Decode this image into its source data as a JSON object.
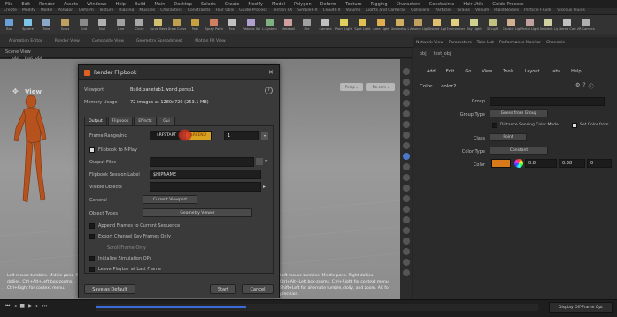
{
  "menubar": [
    "File",
    "Edit",
    "Render",
    "Assets",
    "Windows",
    "Help",
    "Build",
    "Main",
    "Desktop",
    "Solaris",
    "Create",
    "Modify",
    "Model",
    "Polygon",
    "Deform",
    "Texture",
    "Rigging",
    "Characters",
    "Constraints",
    "Hair Utils",
    "Guide Process"
  ],
  "shelf_tabs": [
    "Create",
    "Modify",
    "Model",
    "Polygon",
    "Deform",
    "Texture",
    "Rigging",
    "Muscles",
    "Characters",
    "Constraints",
    "Hair Utils",
    "Guide Process",
    "Terrain FX",
    "Simple FX",
    "Cloud FX",
    "Volume",
    "Lights and Cameras",
    "Collisions",
    "Particles",
    "Grains",
    "Vellum",
    "Rigid Bodies",
    "Particle Fluids",
    "Viscous Fluids"
  ],
  "shelf_tools": [
    {
      "label": "Box",
      "color": "#6aa0d8"
    },
    {
      "label": "Sphere",
      "color": "#7cc4e8"
    },
    {
      "label": "Tube",
      "color": "#8aa8c8"
    },
    {
      "label": "Torus",
      "color": "#c0a060"
    },
    {
      "label": "Grid",
      "color": "#8a8a8a"
    },
    {
      "label": "Null",
      "color": "#b0b0b0"
    },
    {
      "label": "Line",
      "color": "#a0a0a0"
    },
    {
      "label": "Circle",
      "color": "#a8a8a8"
    },
    {
      "label": "Curve Bezier",
      "color": "#d0c070"
    },
    {
      "label": "Draw Curve",
      "color": "#c0a050"
    },
    {
      "label": "Path",
      "color": "#c8a040"
    },
    {
      "label": "Spray Paint",
      "color": "#d08060"
    },
    {
      "label": "Font",
      "color": "#c0c0c0"
    },
    {
      "label": "Platonic Solids",
      "color": "#b0a0d0"
    },
    {
      "label": "L-System",
      "color": "#80b080"
    },
    {
      "label": "Metaball",
      "color": "#d0a0a0"
    },
    {
      "label": "File",
      "color": "#a0a0a0"
    },
    {
      "label": "Camera",
      "color": "#c0c0c0"
    },
    {
      "label": "Point Light",
      "color": "#e0d060"
    },
    {
      "label": "Spot Light",
      "color": "#e0c050"
    },
    {
      "label": "Area Light",
      "color": "#e0b050"
    },
    {
      "label": "Geometry Light",
      "color": "#d0b060"
    },
    {
      "label": "Volume Light",
      "color": "#c0a060"
    },
    {
      "label": "Distant Light",
      "color": "#e0c070"
    },
    {
      "label": "Environment Light",
      "color": "#e0d080"
    },
    {
      "label": "Sky Light",
      "color": "#d0d090"
    },
    {
      "label": "GI Light",
      "color": "#c0c080"
    },
    {
      "label": "Caustic Light",
      "color": "#d0b090"
    },
    {
      "label": "Portal Light",
      "color": "#c0a0a0"
    },
    {
      "label": "Ambient Light",
      "color": "#d0d0a0"
    },
    {
      "label": "Stereo Camera",
      "color": "#c0c0c0"
    },
    {
      "label": "VR Camera",
      "color": "#b0b0b0"
    }
  ],
  "shelf2": [
    "Animation Editor",
    "Render View",
    "Composite View",
    "Geometry Spreadsheet",
    "Motion FX View"
  ],
  "left_pane": {
    "tab": "Scene View",
    "path": [
      "obj",
      "test_obj"
    ]
  },
  "viewport": {
    "title": "View",
    "btn_persp": "Persp ▾",
    "btn_cam": "No cam ▾",
    "hint_left": "Left mouse tumbles. Middle pans.\nRight dollies. Ctrl+Alt+Left box-zooms.\nCtrl+Right for context menu.",
    "hint_right": "Left mouse tumbles. Middle pans. Right dollies. Ctrl+Alt+Left box-zooms. Ctrl+Right for context menu. Shift+Left for alternate tumble, dolly, and zoom. Alt for precision."
  },
  "dialog": {
    "title": "Render Flipbook",
    "viewport_label": "Viewport",
    "viewport_value": "Build.panetab1.world.persp1",
    "memory_label": "Memory Usage",
    "memory_value": "72 images at 1280x720 (253.1 MB)",
    "tabs": [
      "Output",
      "Flipbook",
      "Effects",
      "Gui"
    ],
    "frame_range_label": "Frame Range/Inc",
    "frame_start": "$RFSTART",
    "frame_end": "$RFEND",
    "frame_inc": "1",
    "flipbook_mplay": "Flipbook to MPlay",
    "output_files_label": "Output Files",
    "session_label": "Flipbook Session Label",
    "session_value": "$HIPNAME",
    "visible_objects_label": "Visible Objects",
    "general_label": "General",
    "general_value": "Current Viewport",
    "object_types_label": "Object Types",
    "object_types_value": "Geometry Viewer",
    "opt1": "Append Frames to Current Sequence",
    "opt2": "Export Channel Key Frames Only",
    "opt3": "Scroll Frame Only",
    "opt4": "Initialize Simulation OPs",
    "opt5": "Leave Playbar at Last Frame",
    "btn_save": "Save as Default",
    "btn_start": "Start",
    "btn_cancel": "Cancel"
  },
  "right_panel": {
    "tabs": [
      "Network View",
      "Parameters",
      "Take List",
      "Performance Monitor",
      "Channels"
    ],
    "path": [
      "obj",
      "test_obj"
    ],
    "menu": [
      "Add",
      "Edit",
      "Go",
      "View",
      "Tools",
      "Layout",
      "Labs",
      "Help"
    ],
    "node_type": "Color",
    "node_name": "color2",
    "group_label": "Group",
    "group_type_label": "Group Type",
    "group_type_value": "Guess from Group",
    "distance_label": "Distance Sensing Color Mode",
    "set_color_label": "Set Color from",
    "class_label": "Class",
    "class_value": "Point",
    "color_type_label": "Color Type",
    "color_type_value": "Constant",
    "color_label": "Color",
    "color_r": "0.8",
    "color_g": "0.38",
    "color_b": "0",
    "swatch": "#d97a1a"
  },
  "timeline": {
    "right_button": "Display Off-Frame Opt"
  }
}
